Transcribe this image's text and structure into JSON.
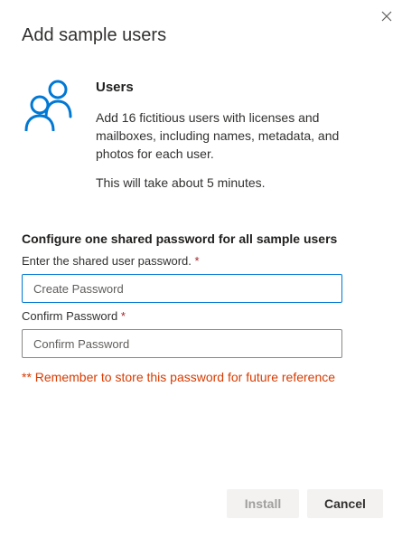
{
  "dialog": {
    "title": "Add sample users",
    "close_icon": "close-icon"
  },
  "users_section": {
    "icon": "users-icon",
    "heading": "Users",
    "description": "Add 16 fictitious users with licenses and mailboxes, including names, metadata, and photos for each user.",
    "duration": "This will take about 5 minutes."
  },
  "password_config": {
    "heading": "Configure one shared password for all sample users",
    "password_label": "Enter the shared user password.",
    "password_required": "*",
    "password_placeholder": "Create Password",
    "password_value": "",
    "confirm_label": "Confirm Password",
    "confirm_required": "*",
    "confirm_placeholder": "Confirm Password",
    "confirm_value": "",
    "reminder": "** Remember to store this password for future reference"
  },
  "footer": {
    "install_label": "Install",
    "install_disabled": true,
    "cancel_label": "Cancel"
  },
  "colors": {
    "accent": "#0078d4",
    "warning": "#d83b01",
    "required": "#a4262c",
    "button_bg": "#f3f2f1",
    "disabled_text": "#a19f9d"
  }
}
